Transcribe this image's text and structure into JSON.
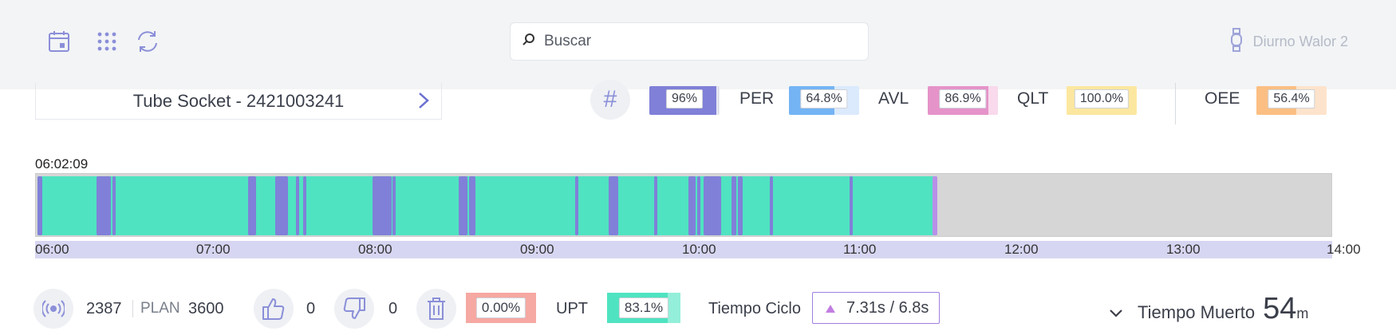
{
  "header": {
    "search_placeholder": "Buscar",
    "user_name": "Diurno Walor 2",
    "icons": [
      "calendar-icon",
      "grid-icon",
      "refresh-icon",
      "search-icon",
      "watch-icon"
    ]
  },
  "product": {
    "name": "Tube Socket - 2421003241"
  },
  "kpis": {
    "oee_main": {
      "value": "96%",
      "fraction": 0.96,
      "color": "#8080d8"
    },
    "per": {
      "label": "PER",
      "value": "64.8%",
      "fraction": 0.648,
      "color": "#74b4f5"
    },
    "avl": {
      "label": "AVL",
      "value": "86.9%",
      "fraction": 0.869,
      "color": "#e593c9"
    },
    "qlt": {
      "label": "QLT",
      "value": "100.0%",
      "fraction": 1.0,
      "color": "#fce7a0"
    },
    "oee": {
      "label": "OEE",
      "value": "56.4%",
      "fraction": 0.564,
      "color": "#fbbf83"
    }
  },
  "timeline": {
    "start_label": "06:02:09",
    "ticks": [
      "06:00",
      "07:00",
      "08:00",
      "09:00",
      "10:00",
      "11:00",
      "12:00",
      "13:00",
      "14:00"
    ],
    "colors": {
      "running": "#4fe3c1",
      "stopped": "#8080d8",
      "idle": "#d6d6d6",
      "end": "#b890e8"
    }
  },
  "stats": {
    "count": "2387",
    "plan_label": "PLAN",
    "plan_value": "3600",
    "likes": "0",
    "dislikes": "0",
    "scrap_value": "0.00%",
    "scrap_color": "#f6a8a2",
    "upt_label": "UPT",
    "upt_value": "83.1%",
    "upt_fraction": 0.831,
    "upt_color": "#4fe3c1",
    "cycle_label": "Tiempo Ciclo",
    "cycle_value": "7.31s",
    "cycle_sep": "/",
    "cycle_target": "6.8s",
    "dead_label": "Tiempo Muerto",
    "dead_value": "54",
    "dead_unit": "m"
  }
}
